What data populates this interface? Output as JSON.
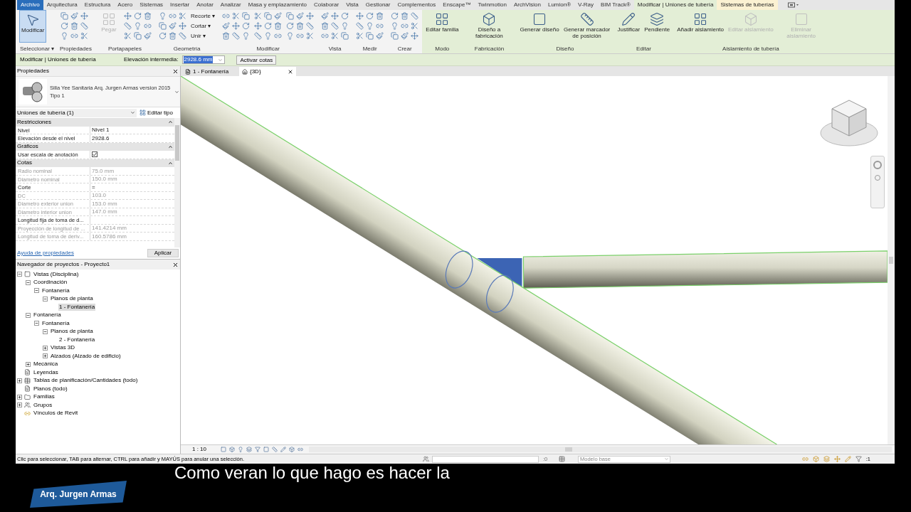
{
  "ribbon_tabs": [
    {
      "label": "Archivo",
      "kind": "file",
      "selected": false
    },
    {
      "label": "Arquitectura",
      "kind": "normal",
      "selected": false
    },
    {
      "label": "Estructura",
      "kind": "normal",
      "selected": false
    },
    {
      "label": "Acero",
      "kind": "normal",
      "selected": false
    },
    {
      "label": "Sistemas",
      "kind": "normal",
      "selected": false
    },
    {
      "label": "Insertar",
      "kind": "normal",
      "selected": false
    },
    {
      "label": "Anotar",
      "kind": "normal",
      "selected": false
    },
    {
      "label": "Analizar",
      "kind": "normal",
      "selected": false
    },
    {
      "label": "Masa y emplazamiento",
      "kind": "normal",
      "selected": false
    },
    {
      "label": "Colaborar",
      "kind": "normal",
      "selected": false
    },
    {
      "label": "Vista",
      "kind": "normal",
      "selected": false
    },
    {
      "label": "Gestionar",
      "kind": "normal",
      "selected": false
    },
    {
      "label": "Complementos",
      "kind": "normal",
      "selected": false
    },
    {
      "label": "Enscape™",
      "kind": "normal",
      "selected": false
    },
    {
      "label": "Twinmotion",
      "kind": "normal",
      "selected": false
    },
    {
      "label": "ArchVision",
      "kind": "normal",
      "selected": false
    },
    {
      "label": "Lumion®",
      "kind": "normal",
      "selected": false
    },
    {
      "label": "V-Ray",
      "kind": "normal",
      "selected": false
    },
    {
      "label": "BIM Track®",
      "kind": "normal",
      "selected": false
    },
    {
      "label": "Modificar | Uniones de tubería",
      "kind": "contextual",
      "selected": true
    },
    {
      "label": "Sistemas de tuberías",
      "kind": "contextual",
      "selected": false
    }
  ],
  "ribbon_groups": [
    {
      "label": "Seleccionar ▾",
      "contextual": false,
      "tools": [
        {
          "kind": "large",
          "label": "Modificar",
          "selected": true,
          "disabled": false
        }
      ]
    },
    {
      "label": "Propiedades",
      "contextual": false,
      "tools": [
        {
          "kind": "icons"
        }
      ]
    },
    {
      "label": "Portapapeles",
      "contextual": false,
      "tools": [
        {
          "kind": "large",
          "label": "Pegar",
          "selected": false,
          "disabled": true
        },
        {
          "kind": "icons"
        }
      ]
    },
    {
      "label": "Geometría",
      "contextual": false,
      "tools": [
        {
          "kind": "small",
          "label": "Recorte ▾"
        },
        {
          "kind": "small",
          "label": "Cortar ▾"
        },
        {
          "kind": "small",
          "label": "Unir ▾"
        },
        {
          "kind": "icons"
        }
      ]
    },
    {
      "label": "Modificar",
      "contextual": false,
      "tools": [
        {
          "kind": "icons"
        },
        {
          "kind": "icons"
        },
        {
          "kind": "icons"
        }
      ]
    },
    {
      "label": "Vista",
      "contextual": false,
      "tools": [
        {
          "kind": "icons"
        }
      ]
    },
    {
      "label": "Medir",
      "contextual": false,
      "tools": [
        {
          "kind": "icons"
        }
      ]
    },
    {
      "label": "Crear",
      "contextual": false,
      "tools": [
        {
          "kind": "icons"
        }
      ]
    },
    {
      "label": "Modo",
      "contextual": true,
      "tools": [
        {
          "kind": "large",
          "label": "Editar familia",
          "selected": false,
          "disabled": false
        }
      ]
    },
    {
      "label": "Fabricación",
      "contextual": true,
      "tools": [
        {
          "kind": "large",
          "label": "Diseño a fabricación",
          "selected": false,
          "disabled": false
        }
      ]
    },
    {
      "label": "Diseño",
      "contextual": true,
      "tools": [
        {
          "kind": "large",
          "label": "Generar diseño",
          "selected": false,
          "disabled": false
        },
        {
          "kind": "large",
          "label": "Generar marcador de posición",
          "selected": false,
          "disabled": false
        }
      ]
    },
    {
      "label": "Editar",
      "contextual": true,
      "tools": [
        {
          "kind": "large",
          "label": "Justificar",
          "selected": false,
          "disabled": false
        },
        {
          "kind": "large",
          "label": "Pendiente",
          "selected": false,
          "disabled": false
        }
      ]
    },
    {
      "label": "Aislamiento de tubería",
      "contextual": true,
      "tools": [
        {
          "kind": "large",
          "label": "Añadir aislamiento",
          "selected": false,
          "disabled": false
        },
        {
          "kind": "large",
          "label": "Editar aislamiento",
          "selected": false,
          "disabled": true
        },
        {
          "kind": "large",
          "label": "Eliminar aislamiento",
          "selected": false,
          "disabled": true
        }
      ]
    }
  ],
  "options_bar": {
    "context": "Modificar | Uniones de tubería",
    "elevation_label": "Elevación intermedia:",
    "elevation_value": "2928.6 mm",
    "button": "Activar cotas"
  },
  "properties": {
    "title": "Propiedades",
    "type_name": "Silla Yee Sanitaria Arq. Jurgen Armas version 2015",
    "type_sub": "Tipo 1",
    "selector": "Uniones de tubería (1)",
    "edit_type": "Editar tipo",
    "sections": [
      {
        "label": "Restricciones",
        "expanded": true,
        "rows": [
          {
            "name": "Nivel",
            "value": "Nivel 1",
            "kind": "text",
            "disabled": false
          },
          {
            "name": "Elevación desde el nivel",
            "value": "2928.6",
            "kind": "text",
            "disabled": false
          }
        ]
      },
      {
        "label": "Gráficos",
        "expanded": true,
        "rows": [
          {
            "name": "Usar escala de anotación",
            "kind": "checkbox",
            "checked": true,
            "disabled": false
          }
        ]
      },
      {
        "label": "Cotas",
        "expanded": true,
        "rows": [
          {
            "name": "Radio nominal",
            "value": "75.0 mm",
            "kind": "text",
            "disabled": true
          },
          {
            "name": "Diametro nominal",
            "value": "150.0 mm",
            "kind": "text",
            "disabled": true
          },
          {
            "name": "Corte",
            "value": "=",
            "kind": "editing",
            "disabled": false
          },
          {
            "name": "DC",
            "value": "103.0",
            "kind": "text",
            "disabled": true
          },
          {
            "name": "Diametro exterior union",
            "value": "153.0 mm",
            "kind": "text",
            "disabled": true
          },
          {
            "name": "Diametro interior union",
            "value": "147.0 mm",
            "kind": "text",
            "disabled": true
          },
          {
            "name": "Longitud fija de toma de d...",
            "value": "",
            "kind": "text",
            "disabled": false
          },
          {
            "name": "Proyección de longitud de ...",
            "value": "141.4214 mm",
            "kind": "text",
            "disabled": true
          },
          {
            "name": "Longitud de toma de deriv...",
            "value": "160.5786 mm",
            "kind": "text",
            "disabled": true
          }
        ]
      }
    ],
    "help_link": "Ayuda de propiedades",
    "apply": "Aplicar"
  },
  "browser": {
    "title": "Navegador de proyectos - Proyecto1",
    "items": [
      {
        "label": "Vistas (Disciplina)",
        "kind": "views",
        "expanded": true,
        "selected": false,
        "children": [
          {
            "label": "Coordinación",
            "expanded": true,
            "selected": false,
            "children": [
              {
                "label": "Fontanería",
                "expanded": true,
                "selected": false,
                "children": [
                  {
                    "label": "Planos de planta",
                    "expanded": true,
                    "selected": false,
                    "children": [
                      {
                        "label": "1 - Fontanería",
                        "selected": true
                      }
                    ]
                  }
                ]
              }
            ]
          },
          {
            "label": "Fontanería",
            "expanded": true,
            "selected": false,
            "children": [
              {
                "label": "Fontanería",
                "expanded": true,
                "selected": false,
                "children": [
                  {
                    "label": "Planos de planta",
                    "expanded": true,
                    "selected": false,
                    "children": [
                      {
                        "label": "2 - Fontanería",
                        "selected": false
                      }
                    ]
                  },
                  {
                    "label": "Vistas 3D",
                    "expanded": false,
                    "selected": false
                  },
                  {
                    "label": "Alzados (Alzado de edificio)",
                    "expanded": false,
                    "selected": false
                  }
                ]
              }
            ]
          },
          {
            "label": "Mecánica",
            "expanded": false,
            "selected": false
          }
        ]
      },
      {
        "label": "Leyendas",
        "kind": "legends",
        "selected": false
      },
      {
        "label": "Tablas de planificación/Cantidades (todo)",
        "kind": "schedules",
        "expanded": false,
        "selected": false
      },
      {
        "label": "Planos (todo)",
        "kind": "sheets",
        "selected": false
      },
      {
        "label": "Familias",
        "kind": "families",
        "expanded": false,
        "selected": false
      },
      {
        "label": "Grupos",
        "kind": "groups",
        "expanded": false,
        "selected": false
      },
      {
        "label": "Vínculos de Revit",
        "kind": "links",
        "selected": false
      }
    ]
  },
  "view_tabs": [
    {
      "label": "1 - Fontanería",
      "kind": "plan",
      "selected": false
    },
    {
      "label": "{3D}",
      "kind": "model",
      "selected": true
    }
  ],
  "view_bar": {
    "scale": "1 : 10"
  },
  "status_bar": {
    "hint": "Clic para seleccionar, TAB para alternar, CTRL para añadir y MAYÚS para anular una selección.",
    "count": ":0",
    "model": "Modelo base",
    "filter": ":1"
  },
  "overlay": {
    "logo": "Arq. Jurgen Armas",
    "subtitle": "Como veran lo que hago es hacer la"
  }
}
